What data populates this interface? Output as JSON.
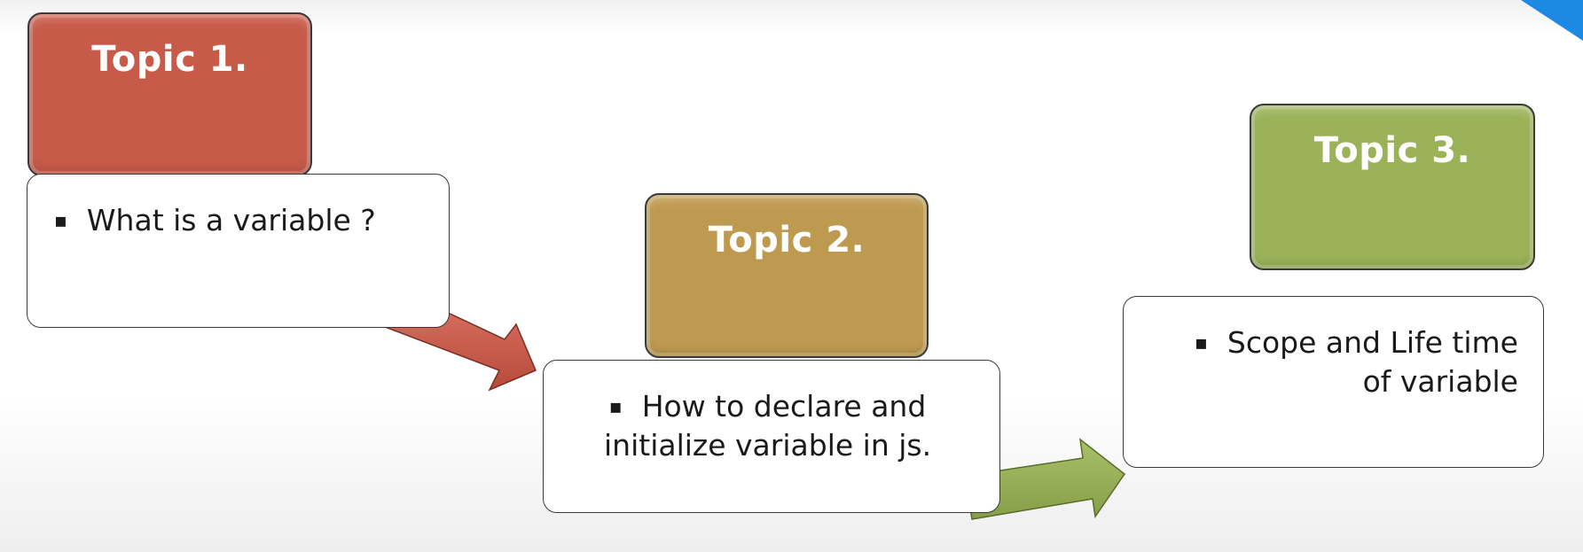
{
  "colors": {
    "topic1": "#c85a4a",
    "topic2": "#be9a50",
    "topic3": "#9bb259",
    "corner_accent": "#1e88e5"
  },
  "topics": [
    {
      "title": "Topic 1.",
      "bullet": "▪",
      "lines": [
        "What is a variable ?"
      ]
    },
    {
      "title": "Topic 2.",
      "bullet": "▪",
      "lines": [
        "How to declare and",
        "initialize variable in js."
      ]
    },
    {
      "title": "Topic 3.",
      "bullet": "▪",
      "lines": [
        "Scope and Life time",
        "of variable"
      ]
    }
  ]
}
